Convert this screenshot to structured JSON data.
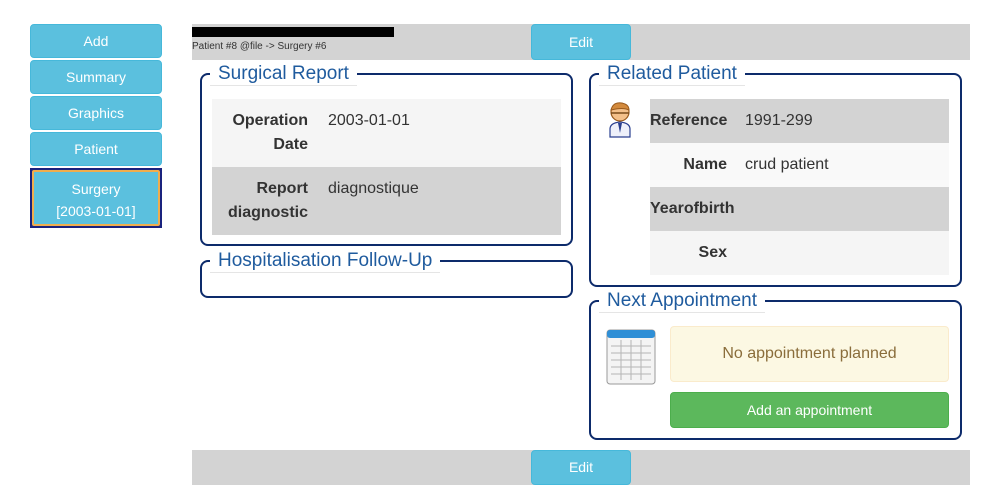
{
  "sidebar": {
    "add": "Add",
    "summary": "Summary",
    "graphics": "Graphics",
    "patient": "Patient",
    "surgery_line1": "Surgery",
    "surgery_line2": "[2003-01-01]"
  },
  "topbar": {
    "breadcrumb": "Patient #8 @file -> Surgery #6",
    "edit": "Edit"
  },
  "bottombar": {
    "edit": "Edit"
  },
  "surgical_report": {
    "title": "Surgical Report",
    "rows": [
      {
        "label_1": "Operation",
        "label_2": "Date",
        "value": "2003-01-01"
      },
      {
        "label_1": "Report",
        "label_2": "diagnostic",
        "value": "diagnostique"
      }
    ]
  },
  "hospitalisation": {
    "title": "Hospitalisation Follow-Up"
  },
  "related_patient": {
    "title": "Related Patient",
    "icon": "patient-avatar-icon",
    "rows": [
      {
        "label": "Reference",
        "value": "1991-299"
      },
      {
        "label": "Name",
        "value": "crud patient"
      },
      {
        "label": "Yearofbirth",
        "value": ""
      },
      {
        "label": "Sex",
        "value": ""
      }
    ]
  },
  "next_appointment": {
    "title": "Next Appointment",
    "icon": "calendar-table-icon",
    "notice": "No appointment planned",
    "add_button": "Add an appointment"
  },
  "colors": {
    "info_button": "#5bc0de",
    "panel_border": "#0d2b6b",
    "legend_text": "#1f5b9e",
    "success": "#5cb85c",
    "warning_bg": "#fcf8e3"
  }
}
